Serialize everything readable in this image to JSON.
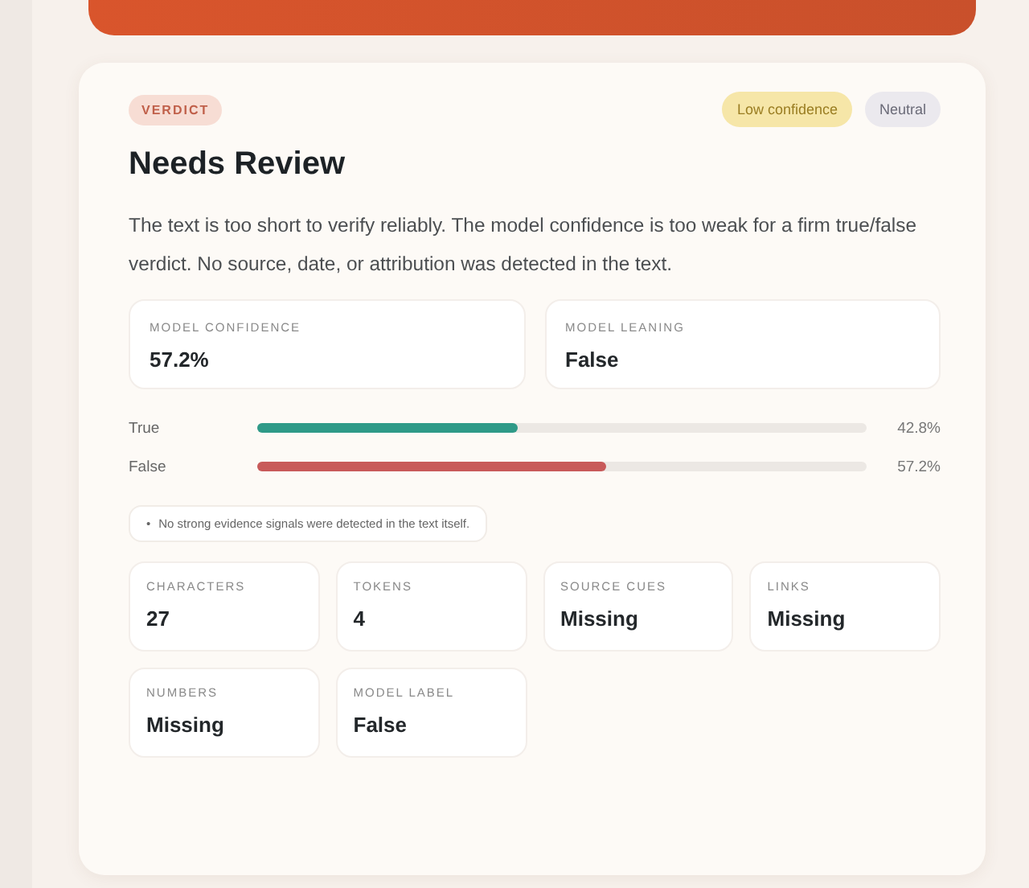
{
  "verdict": {
    "tag": "VERDICT",
    "badges": [
      {
        "label": "Low confidence",
        "kind": "warning"
      },
      {
        "label": "Neutral",
        "kind": "neutral"
      }
    ],
    "title": "Needs Review",
    "summary": "The text is too short to verify reliably. The model confidence is too weak for a firm true/false verdict. No source, date, or attribution was detected in the text."
  },
  "metrics": [
    {
      "label": "MODEL CONFIDENCE",
      "value": "57.2%"
    },
    {
      "label": "MODEL LEANING",
      "value": "False"
    }
  ],
  "bars": [
    {
      "label": "True",
      "level": 0.428,
      "reading": "42.8%",
      "color": "#2f9a88"
    },
    {
      "label": "False",
      "level": 0.572,
      "reading": "57.2%",
      "color": "#c85a5a"
    }
  ],
  "note": {
    "bullet": "•",
    "text": "No strong evidence signals were detected in the text itself."
  },
  "stats": [
    {
      "label": "CHARACTERS",
      "value": "27"
    },
    {
      "label": "TOKENS",
      "value": "4"
    },
    {
      "label": "SOURCE CUES",
      "value": "Missing"
    },
    {
      "label": "LINKS",
      "value": "Missing"
    },
    {
      "label": "NUMBERS",
      "value": "Missing"
    },
    {
      "label": "MODEL LABEL",
      "value": "False"
    }
  ]
}
